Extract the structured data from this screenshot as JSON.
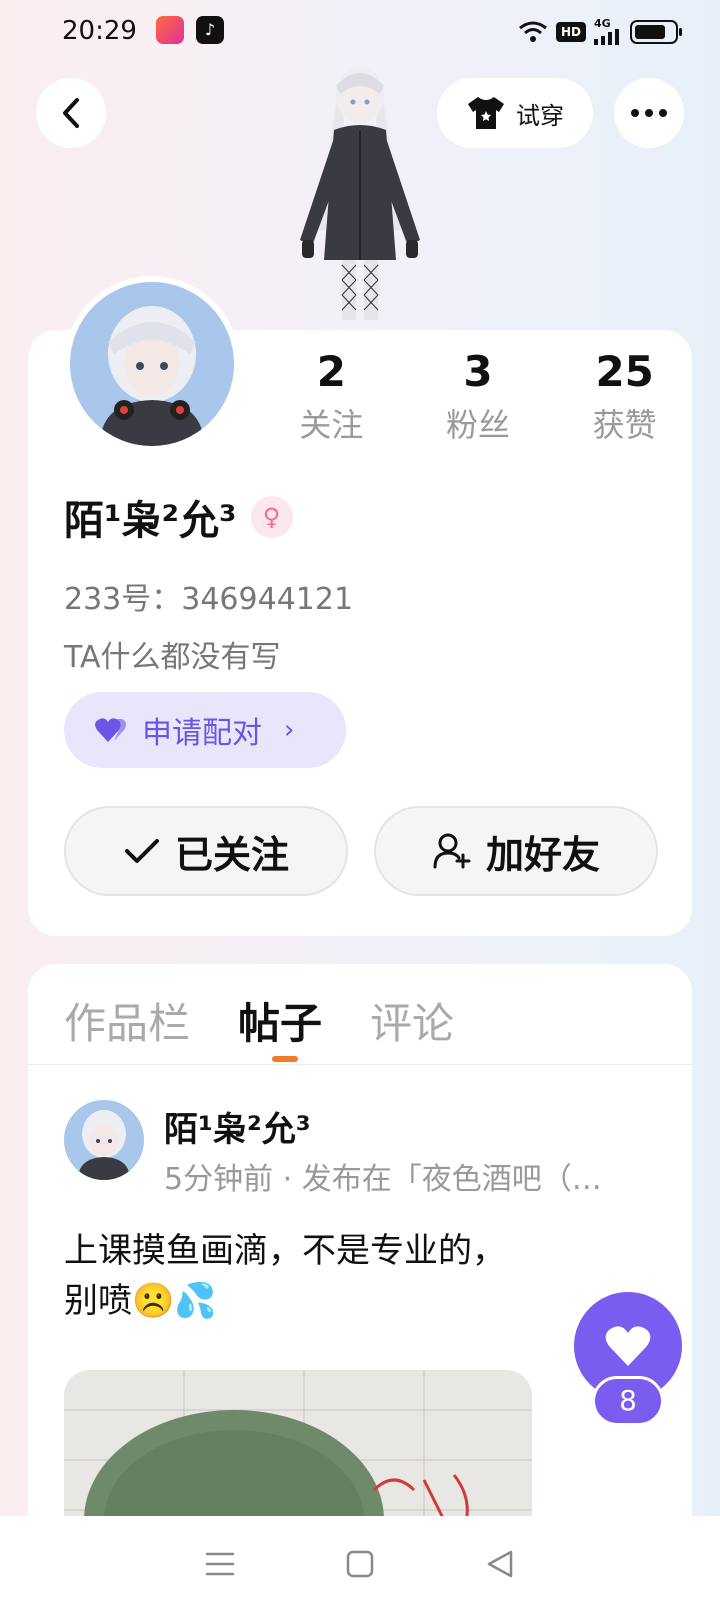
{
  "status_bar": {
    "time": "20:29",
    "network": "4G",
    "hd": "HD"
  },
  "top_nav": {
    "try_on_label": "试穿"
  },
  "profile": {
    "stats": [
      {
        "value": "2",
        "label": "关注"
      },
      {
        "value": "3",
        "label": "粉丝"
      },
      {
        "value": "25",
        "label": "获赞"
      }
    ],
    "username": "陌¹枭²允³",
    "uid_text": "233号：346944121",
    "bio": "TA什么都没有写",
    "pair_label": "申请配对",
    "follow_label": "已关注",
    "add_friend_label": "加好友"
  },
  "tabs": [
    {
      "label": "作品栏",
      "active": false
    },
    {
      "label": "帖子",
      "active": true
    },
    {
      "label": "评论",
      "active": false
    }
  ],
  "post": {
    "author": "陌¹枭²允³",
    "meta": "5分钟前 · 发布在「夜色酒吧（…",
    "text_line1": "上课摸鱼画滴，不是专业的，",
    "text_line2": "别喷☹️💦"
  },
  "like_count": "8",
  "colors": {
    "accent": "#7a5cf0",
    "tab_underline": "#f07b2a",
    "pair_bg": "#e8e6fb"
  }
}
